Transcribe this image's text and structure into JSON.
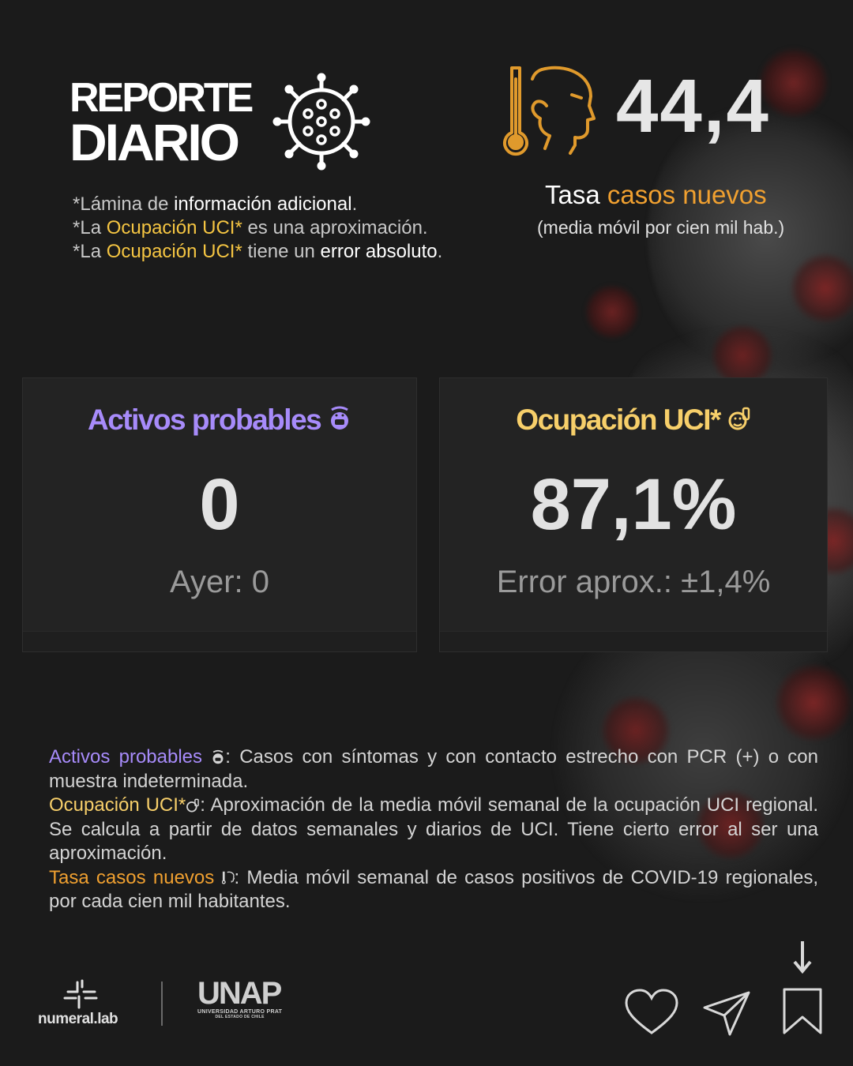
{
  "header": {
    "title_line1": "REPORTE",
    "title_line2": "DIARIO"
  },
  "notes": {
    "n1_prefix": "*Lámina de ",
    "n1_hl": "información adicional",
    "n1_suffix": ".",
    "n2_prefix": "*La ",
    "n2_hl": "Ocupación UCI*",
    "n2_suffix": " es una aproximación.",
    "n3_prefix": "*La ",
    "n3_hl": "Ocupación UCI*",
    "n3_mid": " tiene un ",
    "n3_hl2": "error absoluto",
    "n3_suffix": "."
  },
  "rate": {
    "value": "44,4",
    "label_prefix": "Tasa ",
    "label_hl": "casos nuevos",
    "sub": "(media móvil por cien mil hab.)"
  },
  "cards": {
    "activos": {
      "title": "Activos probables",
      "value": "0",
      "sub": "Ayer: 0"
    },
    "uci": {
      "title": "Ocupación UCI*",
      "value": "87,1%",
      "sub": "Error aprox.: ±1,4%"
    }
  },
  "legend": {
    "activos_term": "Activos probables",
    "activos_desc": ": Casos con síntomas y con contacto estrecho con PCR (+) o con muestra indeterminada.",
    "uci_term": "Ocupación UCI*",
    "uci_desc": ": Aproximación de la media móvil semanal de la ocupación UCI regional. Se calcula a partir de datos semanales y diarios de UCI. Tiene cierto error al ser una aproximación.",
    "tasa_term": "Tasa casos nuevos",
    "tasa_desc": ": Media móvil semanal de casos positivos de COVID-19 regionales, por cada cien mil habitantes."
  },
  "footer": {
    "numeral_lab": "numeral.lab",
    "unap": "UNAP",
    "unap_sub1": "UNIVERSIDAD ARTURO PRAT",
    "unap_sub2": "DEL ESTADO DE CHILE"
  },
  "colors": {
    "background": "#1b1b1b",
    "purple": "#a78bfa",
    "yellow": "#f7cf6a",
    "orange": "#f0a030"
  },
  "icons": [
    "virus-icon",
    "thermometer-face-icon",
    "mask-face-icon",
    "patient-icon",
    "heart-icon",
    "send-icon",
    "bookmark-icon",
    "arrow-down-icon"
  ]
}
